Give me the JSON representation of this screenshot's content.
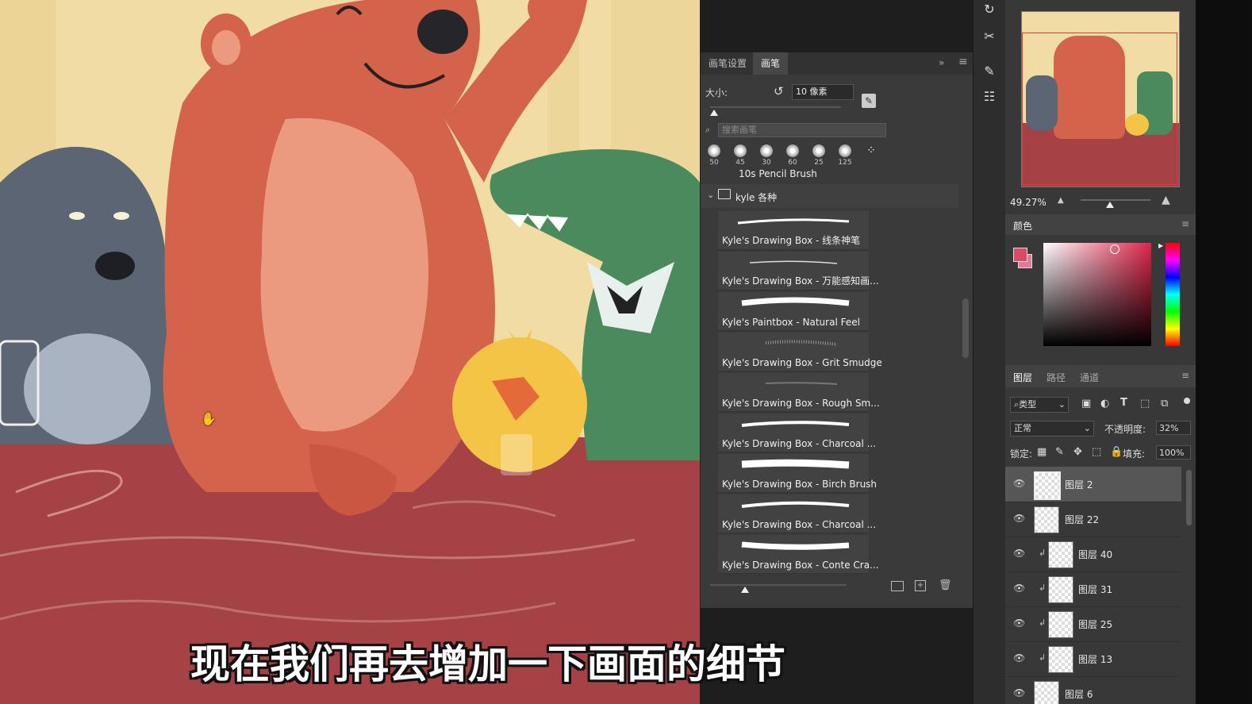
{
  "brush_panel": {
    "tabs": [
      "画笔设置",
      "画笔"
    ],
    "size_label": "大小:",
    "size_value": "10 像素",
    "search_placeholder": "搜索画笔",
    "tips": [
      "50",
      "45",
      "30",
      "60",
      "25",
      "125"
    ],
    "recent_brush_name": "10s Pencil Brush",
    "group_name": "kyle 各种",
    "brushes": [
      "Kyle's Drawing Box - 线条神笔",
      "Kyle's Drawing Box - 万能感知画...",
      "Kyle's Paintbox - Natural Feel",
      "Kyle's Drawing Box - Grit Smudge",
      "Kyle's Drawing Box - Rough Sm...",
      "Kyle's Drawing Box - Charcoal ...",
      "Kyle's Drawing Box - Birch Brush",
      "Kyle's Drawing Box - Charcoal ...",
      "Kyle's Drawing Box - Conte Cra..."
    ]
  },
  "navigator": {
    "zoom": "49.27%"
  },
  "color_panel": {
    "title": "颜色",
    "foreground": "#d94b63",
    "background": "#e07a9a"
  },
  "layers_panel": {
    "tabs": [
      "图层",
      "路径",
      "通道"
    ],
    "filter_label": "类型",
    "blend_mode": "正常",
    "opacity_label": "不透明度:",
    "opacity_value": "32%",
    "lock_label": "锁定:",
    "fill_label": "填充:",
    "fill_value": "100%",
    "layers": [
      {
        "name": "图层 2",
        "selected": true,
        "clipped": false
      },
      {
        "name": "图层 22",
        "selected": false,
        "clipped": false
      },
      {
        "name": "图层 40",
        "selected": false,
        "clipped": true
      },
      {
        "name": "图层 31",
        "selected": false,
        "clipped": true
      },
      {
        "name": "图层 25",
        "selected": false,
        "clipped": true
      },
      {
        "name": "图层 13",
        "selected": false,
        "clipped": true
      },
      {
        "name": "图层 6",
        "selected": false,
        "clipped": false
      }
    ]
  },
  "subtitle": "现在我们再去增加一下画面的细节"
}
